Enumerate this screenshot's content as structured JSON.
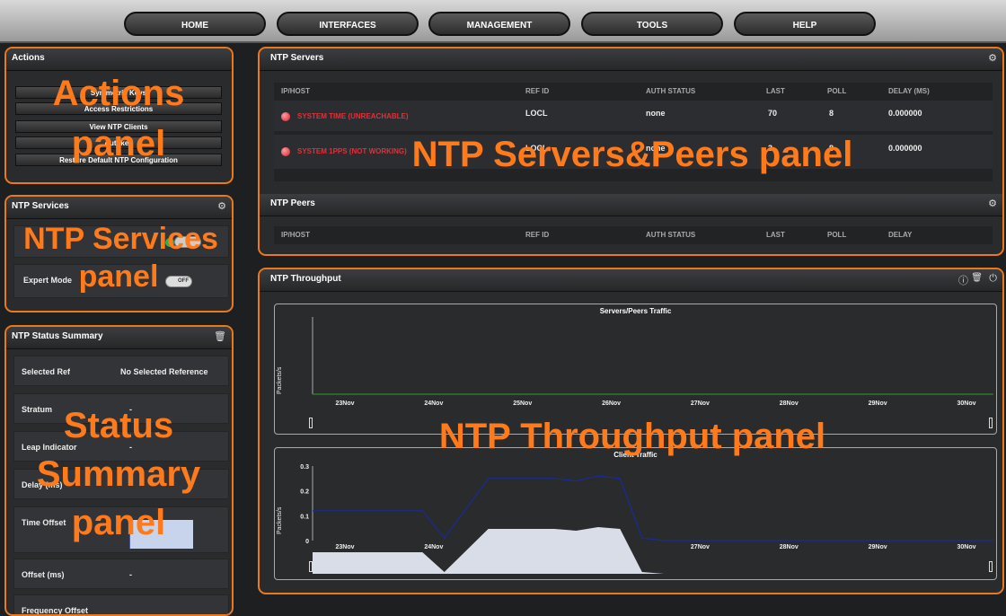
{
  "nav": [
    "HOME",
    "INTERFACES",
    "MANAGEMENT",
    "TOOLS",
    "HELP"
  ],
  "actions": {
    "title": "Actions",
    "buttons": [
      "Symmetric Keys",
      "Access Restrictions",
      "View NTP Clients",
      "Autokey",
      "Restore Default NTP Configuration"
    ],
    "overlay_line1": "Actions",
    "overlay_line2": "panel"
  },
  "services": {
    "title": "NTP Services",
    "expert_label": "Expert Mode",
    "expert_state": "OFF",
    "overlay_line1": "NTP Services",
    "overlay_line2": "panel"
  },
  "status": {
    "title": "NTP Status Summary",
    "rows": [
      {
        "label": "Selected Ref",
        "value": "No Selected Reference"
      },
      {
        "label": "Stratum",
        "value": "-"
      },
      {
        "label": "Leap Indicator",
        "value": "-"
      },
      {
        "label": "Delay (ms)",
        "value": ""
      },
      {
        "label": "Time Offset",
        "value": ""
      },
      {
        "label": "Offset (ms)",
        "value": "-"
      },
      {
        "label": "Frequency Offset",
        "value": ""
      }
    ],
    "overlay_line1": "Status",
    "overlay_line2": "Summary",
    "overlay_line3": "panel"
  },
  "servers": {
    "title": "NTP Servers",
    "headers": [
      "IP/HOST",
      "REF ID",
      "AUTH STATUS",
      "LAST",
      "POLL",
      "DELAY (MS)"
    ],
    "rows": [
      {
        "host": "SYSTEM TIME (UNREACHABLE)",
        "refid": "LOCL",
        "auth": "none",
        "last": "70",
        "poll": "8",
        "delay": "0.000000"
      },
      {
        "host": "SYSTEM 1PPS (NOT WORKING)",
        "refid": "LOCL",
        "auth": "none",
        "last": "3",
        "poll": "8",
        "delay": "0.000000"
      }
    ],
    "overlay": "NTP Servers&Peers panel"
  },
  "peers": {
    "title": "NTP Peers",
    "headers": [
      "IP/HOST",
      "REF ID",
      "AUTH STATUS",
      "LAST",
      "POLL",
      "DELAY"
    ]
  },
  "throughput": {
    "title": "NTP Throughput",
    "overlay": "NTP Throughput panel",
    "ylabel": "Packets/s"
  },
  "chart_data": [
    {
      "type": "line",
      "title": "Servers/Peers Traffic",
      "ylabel": "Packets/s",
      "x": [
        "23Nov",
        "24Nov",
        "25Nov",
        "26Nov",
        "27Nov",
        "28Nov",
        "29Nov",
        "30Nov"
      ],
      "series": [
        {
          "values": [
            0,
            0,
            0,
            0,
            0,
            0,
            0,
            0
          ]
        }
      ]
    },
    {
      "type": "line",
      "title": "Client Traffic",
      "ylabel": "Packets/s",
      "ylim": [
        0,
        0.3
      ],
      "yticks": [
        "0",
        "0.1",
        "0.2",
        "0.3"
      ],
      "x": [
        "23Nov",
        "24Nov",
        "25Nov",
        "26Nov",
        "27Nov",
        "28Nov",
        "29Nov",
        "30Nov"
      ],
      "series": [
        {
          "values": [
            0.12,
            0.12,
            0.12,
            0.12,
            0.12,
            0.12,
            0.01,
            0.13,
            0.25,
            0.25,
            0.25,
            0.25,
            0.24,
            0.26,
            0.25,
            0.01,
            0,
            0,
            0,
            0,
            0,
            0,
            0,
            0,
            0,
            0,
            0,
            0,
            0,
            0,
            0,
            0
          ]
        }
      ]
    }
  ]
}
